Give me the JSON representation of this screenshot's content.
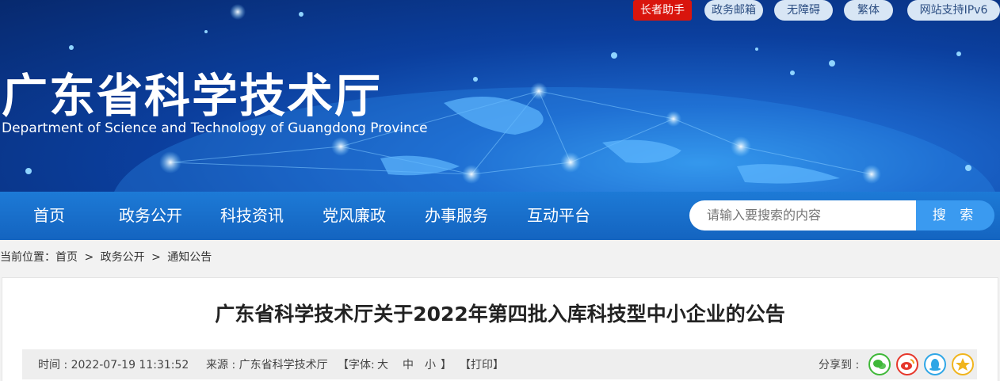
{
  "header": {
    "site_title": "广东省科学技术厅",
    "site_subtitle": "Department of Science and Technology of Guangdong Province",
    "top_links": [
      "长者助手",
      "政务邮箱",
      "无障碍",
      "繁体",
      "网站支持IPv6"
    ]
  },
  "nav": {
    "items": [
      "首页",
      "政务公开",
      "科技资讯",
      "党风廉政",
      "办事服务",
      "互动平台"
    ],
    "search_placeholder": "请输入要搜索的内容",
    "search_button": "搜 索"
  },
  "breadcrumb": {
    "prefix": "当前位置：",
    "items": [
      "首页",
      "政务公开",
      "通知公告"
    ],
    "separator": ">"
  },
  "article": {
    "title": "广东省科学技术厅关于2022年第四批入库科技型中小企业的公告",
    "time": "时间 : 2022-07-19 11:31:52",
    "source": "来源 : 广东省科学技术厅",
    "font_label": "【字体:",
    "font_large": "大",
    "font_medium": "中",
    "font_small": "小",
    "font_close": "】",
    "print": "【打印】",
    "share_label": "分享到 :"
  },
  "share_icons": [
    "wechat-icon",
    "weibo-icon",
    "qq-icon",
    "qzone-icon"
  ],
  "colors": {
    "nav_blue": "#1464c0",
    "elder_red": "#d9150d",
    "search_button": "#3a9af0",
    "wechat": "#3fb838",
    "weibo": "#e6372b",
    "qq": "#2ea6e6",
    "qzone": "#f0b41c"
  }
}
